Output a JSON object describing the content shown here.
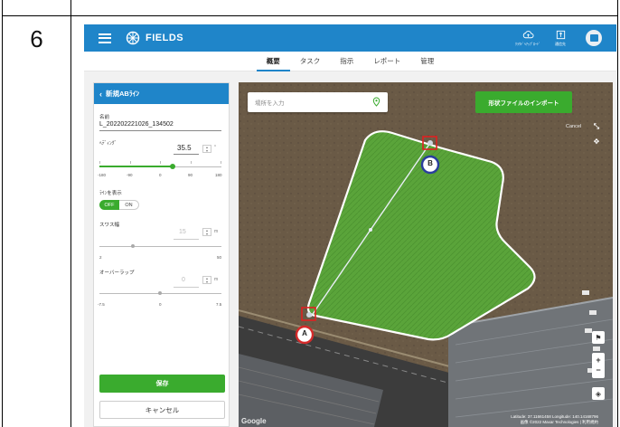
{
  "doc": {
    "step_number": "6"
  },
  "app": {
    "brand": "FIELDS",
    "topbar_buttons": [
      {
        "icon": "cloud-upload-icon",
        "caption": "ｸﾗｳﾄﾞﾍｱｯﾌﾟﾛｰﾄﾞ"
      },
      {
        "icon": "export-icon",
        "caption": "通信先"
      }
    ]
  },
  "nav": {
    "tabs": [
      "概要",
      "タスク",
      "指示",
      "レポート",
      "管理"
    ],
    "active": "概要"
  },
  "panel": {
    "title": "新規ABﾗｲﾝ",
    "name_label": "名前",
    "name_value": "L_202202221026_134502",
    "heading_label": "ﾍﾃﾞｨﾝｸﾞ",
    "heading_value": "35.5",
    "heading_unit": "°",
    "heading_scale": [
      "-180",
      "-90",
      "0",
      "90",
      "180"
    ],
    "heading_fraction": 0.599,
    "show_line_label": "ﾗｲﾝを表示",
    "toggle_off": "OFF",
    "toggle_on": "ON",
    "swath_label": "スワス幅",
    "swath_value": "15",
    "swath_unit": "m",
    "swath_scale": [
      "2",
      "50"
    ],
    "overlap_label": "オーバーラップ",
    "overlap_value": "0",
    "overlap_unit": "m",
    "overlap_scale": [
      "-7.5",
      "0",
      "7.5"
    ],
    "save_label": "保存",
    "cancel_label": "キャンセル"
  },
  "map": {
    "search_placeholder": "場所を入力",
    "import_label": "形状ファイルのインポート",
    "cancel_text": "Cancel",
    "marker_a": "A",
    "marker_b": "B",
    "attribution_line1": "Latitude: 37.11661458  Longitude: 140.14168796",
    "attribution_line2": "画像 ©2022 Maxar Technologies | 利用規約",
    "google": "Google",
    "colors": {
      "field": "#5aa43a",
      "boundary": "#ffffff",
      "marker_a": "#d42a2a",
      "marker_b": "#2a3d9e"
    }
  }
}
